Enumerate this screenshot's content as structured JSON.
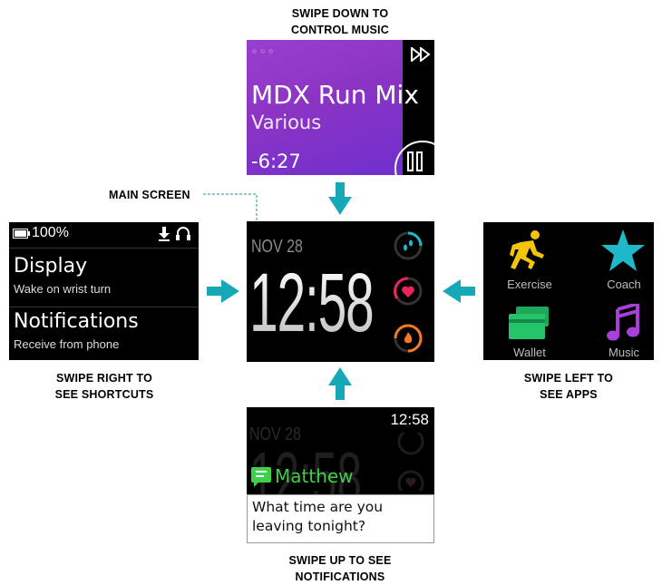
{
  "captions": {
    "top": [
      "SWIPE DOWN TO",
      "CONTROL MUSIC"
    ],
    "main": "MAIN SCREEN",
    "left": [
      "SWIPE RIGHT TO",
      "SEE SHORTCUTS"
    ],
    "right": [
      "SWIPE LEFT TO",
      "SEE APPS"
    ],
    "bottom": [
      "SWIPE UP TO SEE",
      "NOTIFICATIONS"
    ]
  },
  "music": {
    "dots": "◦◦◦",
    "title": "MDX Run Mix",
    "artist": "Various",
    "time": "-6:27",
    "icons": [
      "fast-forward-icon",
      "pause-icon"
    ]
  },
  "main": {
    "date": "NOV 28",
    "clock": "12:58",
    "icons": [
      "steps-icon",
      "heart-icon",
      "flame-icon"
    ]
  },
  "shortcuts": {
    "battery": "100%",
    "items": [
      {
        "title": "Display",
        "subtitle": "Wake on wrist turn"
      },
      {
        "title": "Notifications",
        "subtitle": "Receive from phone"
      }
    ],
    "icons": [
      "battery-icon",
      "download-icon",
      "headphones-icon"
    ]
  },
  "apps": {
    "items": [
      {
        "label": "Exercise",
        "icon": "runner-icon"
      },
      {
        "label": "Coach",
        "icon": "star-icon"
      },
      {
        "label": "Wallet",
        "icon": "wallet-icon"
      },
      {
        "label": "Music",
        "icon": "music-note-icon"
      }
    ]
  },
  "notification": {
    "ghost_date": "NOV 28",
    "ghost_clock": "12:58",
    "time": "12:58",
    "sender": "Matthew",
    "message": "What time are you leaving tonight?"
  },
  "colors": {
    "arrow": "#17a8b8",
    "music_gradient": [
      "#9a3fd0",
      "#6f2fcf"
    ],
    "runner": "#f2c40c",
    "star": "#1fb8c8",
    "wallet": "#26c46a",
    "music_note": "#a93fd8",
    "sender": "#3fd04a"
  }
}
